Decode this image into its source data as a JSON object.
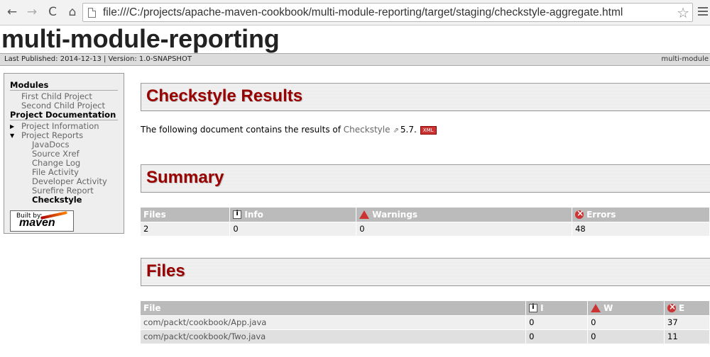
{
  "browser": {
    "back_icon": "←",
    "forward_icon": "→",
    "reload_icon": "C",
    "home_icon": "⌂",
    "url": "file:///C:/projects/apache-maven-cookbook/multi-module-reporting/target/staging/checkstyle-aggregate.html",
    "star_icon": "☆"
  },
  "site": {
    "title": "multi-module-reporting",
    "last_published": "Last Published: 2014-12-13  | Version: 1.0-SNAPSHOT",
    "breadcrumb_right": "multi-module"
  },
  "nav": {
    "modules_heading": "Modules",
    "modules": [
      "First Child Project",
      "Second Child Project"
    ],
    "docs_heading": "Project Documentation",
    "project_information": "Project Information",
    "project_reports": "Project Reports",
    "reports": [
      "JavaDocs",
      "Source Xref",
      "Change Log",
      "File Activity",
      "Developer Activity",
      "Surefire Report",
      "Checkstyle"
    ],
    "built_by_label": "Built by:",
    "built_by_brand": "maven"
  },
  "main": {
    "results_title": "Checkstyle Results",
    "intro_prefix": "The following document contains the results of ",
    "intro_link": "Checkstyle",
    "intro_version": "5.7.",
    "xml_badge": "XML",
    "summary_title": "Summary",
    "summary_headers": [
      "Files",
      "Info",
      "Warnings",
      "Errors"
    ],
    "summary_row": [
      "2",
      "0",
      "0",
      "48"
    ],
    "files_title": "Files",
    "files_headers": [
      "File",
      "I",
      "W",
      "E"
    ],
    "files_rows": [
      [
        "com/packt/cookbook/App.java",
        "0",
        "0",
        "37"
      ],
      [
        "com/packt/cookbook/Two.java",
        "0",
        "0",
        "11"
      ]
    ]
  },
  "colors": {
    "heading_red": "#990000",
    "table_header": "#bbbbbb",
    "nav_background": "#eeeeee"
  }
}
